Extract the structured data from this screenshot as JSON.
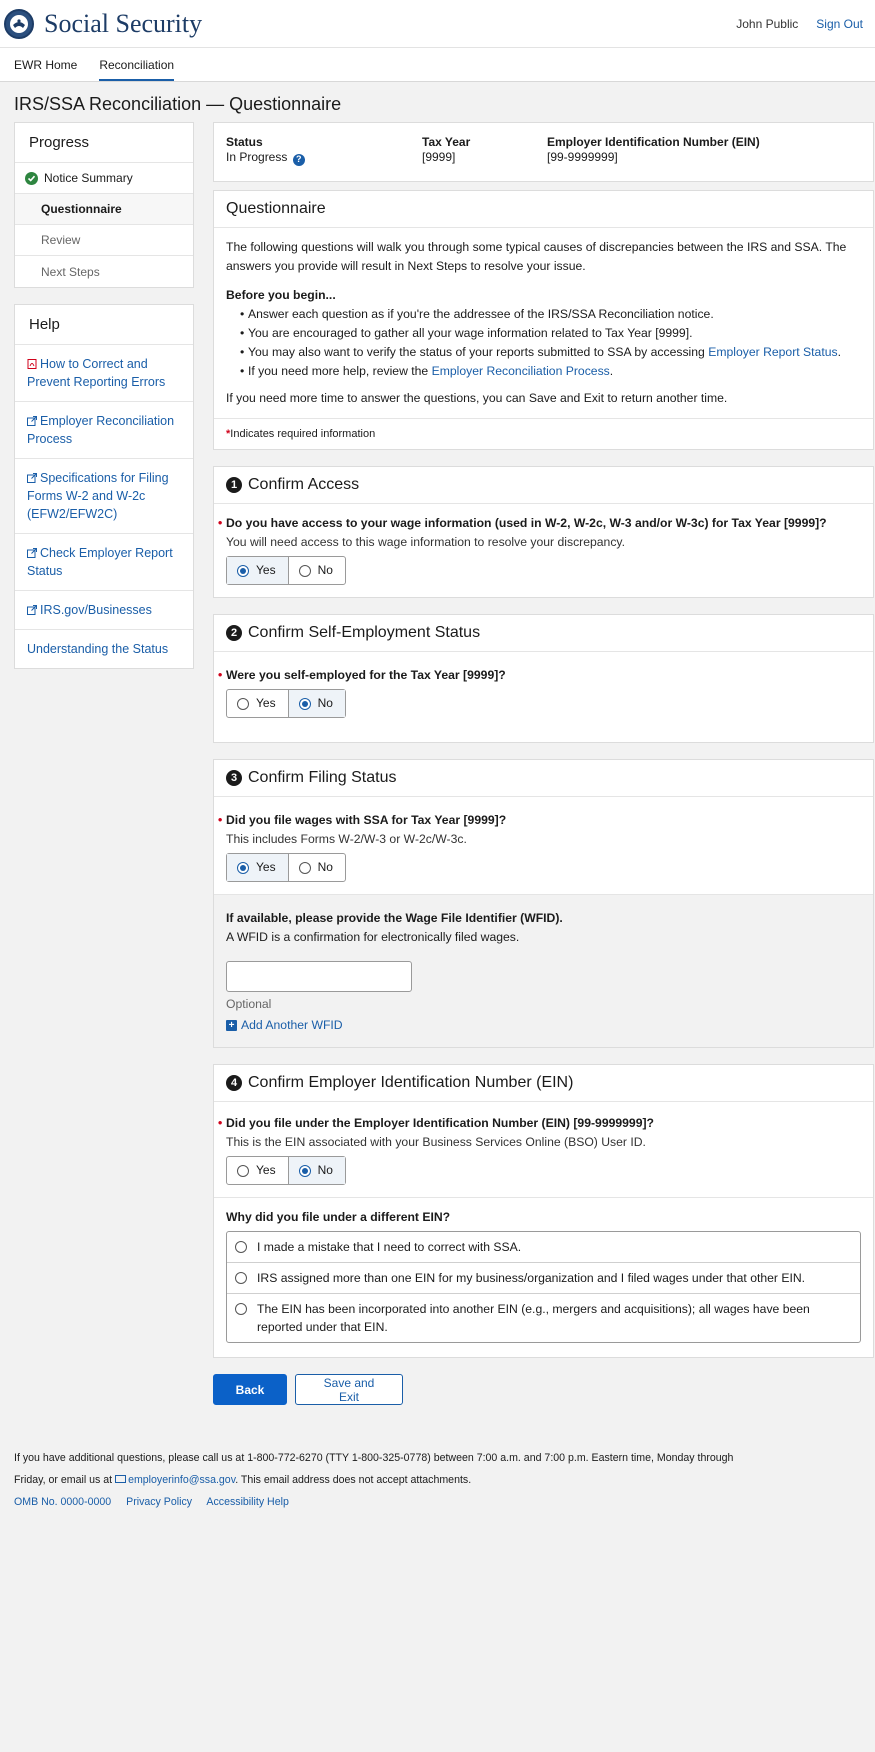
{
  "header": {
    "brand": "Social Security",
    "user_name": "John Public",
    "sign_out": "Sign Out"
  },
  "nav": {
    "tabs": [
      "EWR Home",
      "Reconciliation"
    ],
    "active": "Reconciliation"
  },
  "page_title": "IRS/SSA Reconciliation — Questionnaire",
  "progress": {
    "title": "Progress",
    "items": [
      "Notice Summary",
      "Questionnaire",
      "Review",
      "Next Steps"
    ]
  },
  "help": {
    "title": "Help",
    "links": [
      "How to Correct and Prevent Reporting Errors",
      "Employer Reconciliation Process",
      "Specifications for Filing Forms W-2 and W-2c (EFW2/EFW2C)",
      "Check Employer Report Status",
      "IRS.gov/Businesses",
      "Understanding the Status"
    ]
  },
  "status": {
    "status_label": "Status",
    "status_value": "In Progress",
    "tax_year_label": "Tax Year",
    "tax_year_value": "[9999]",
    "ein_label": "Employer Identification Number (EIN)",
    "ein_value": "[99-9999999]"
  },
  "questionnaire": {
    "title": "Questionnaire",
    "intro": "The following questions will walk you through some typical causes of discrepancies between the IRS and SSA. The answers you provide will result in Next Steps to resolve your issue.",
    "before_title": "Before you begin...",
    "bullet1": "Answer each question as if you're the addressee of the IRS/SSA Reconciliation notice.",
    "bullet2": "You are encouraged to gather all your wage information related to Tax Year [9999].",
    "bullet3_text": "You may also want to verify the status of your reports submitted to SSA by accessing",
    "bullet3_link": "Employer Report Status",
    "bullet4_text": "If you need more help, review the",
    "bullet4_link": "Employer Reconciliation Process",
    "more_time": "If you need more time to answer the questions, you can Save and Exit to return another time.",
    "required_note": "Indicates required information"
  },
  "section1": {
    "title": "Confirm Access",
    "question": "Do you have access to your wage information (used in W-2, W-2c, W-3 and/or W-3c) for Tax Year [9999]?",
    "hint": "You will need access to this wage information to resolve your discrepancy.",
    "yes": "Yes",
    "no": "No",
    "selected": "Yes"
  },
  "section2": {
    "title": "Confirm Self-Employment Status",
    "question": "Were  you self-employed for the Tax Year [9999]?",
    "yes": "Yes",
    "no": "No",
    "selected": "No"
  },
  "section3": {
    "title": "Confirm Filing Status",
    "question": "Did you file wages with SSA for Tax Year [9999]?",
    "hint": "This includes Forms W-2/W-3 or W-2c/W-3c.",
    "yes": "Yes",
    "no": "No",
    "selected": "Yes",
    "wfid_label": "If available, please provide the Wage File Identifier (WFID).",
    "wfid_hint": "A WFID is a confirmation for electronically filed wages.",
    "wfid_value": "",
    "optional": "Optional",
    "add_wfid": "Add Another WFID"
  },
  "section4": {
    "title": "Confirm Employer Identification Number (EIN)",
    "question": "Did you file under the Employer Identification Number (EIN) [99-9999999]?",
    "hint": "This is the EIN associated with your Business Services Online (BSO) User ID.",
    "yes": "Yes",
    "no": "No",
    "selected": "No",
    "why_label": "Why did you file under a different EIN?",
    "reasons": [
      "I made a mistake that I need to correct with SSA.",
      "IRS assigned more than one EIN for my business/organization and I filed wages under that other EIN.",
      "The EIN has been incorporated into another EIN (e.g., mergers and acquisitions); all wages have been reported under that EIN."
    ]
  },
  "buttons": {
    "back": "Back",
    "save_exit": "Save and Exit"
  },
  "footer": {
    "line1": "If you have additional questions, please call us at 1-800-772-6270 (TTY 1-800-325-0778) between 7:00 a.m. and 7:00 p.m. Eastern time, Monday through",
    "line2_pre": "Friday, or email us at",
    "email": "employerinfo@ssa.gov",
    "line2_post": ". This email address does not accept attachments.",
    "omb": "OMB No. 0000-0000",
    "privacy": "Privacy Policy",
    "accessibility": "Accessibility Help"
  },
  "colors": {
    "accent": "#1a5ea8",
    "primary_button": "#0b61c8",
    "success": "#2e8540",
    "required": "#d0021b"
  }
}
